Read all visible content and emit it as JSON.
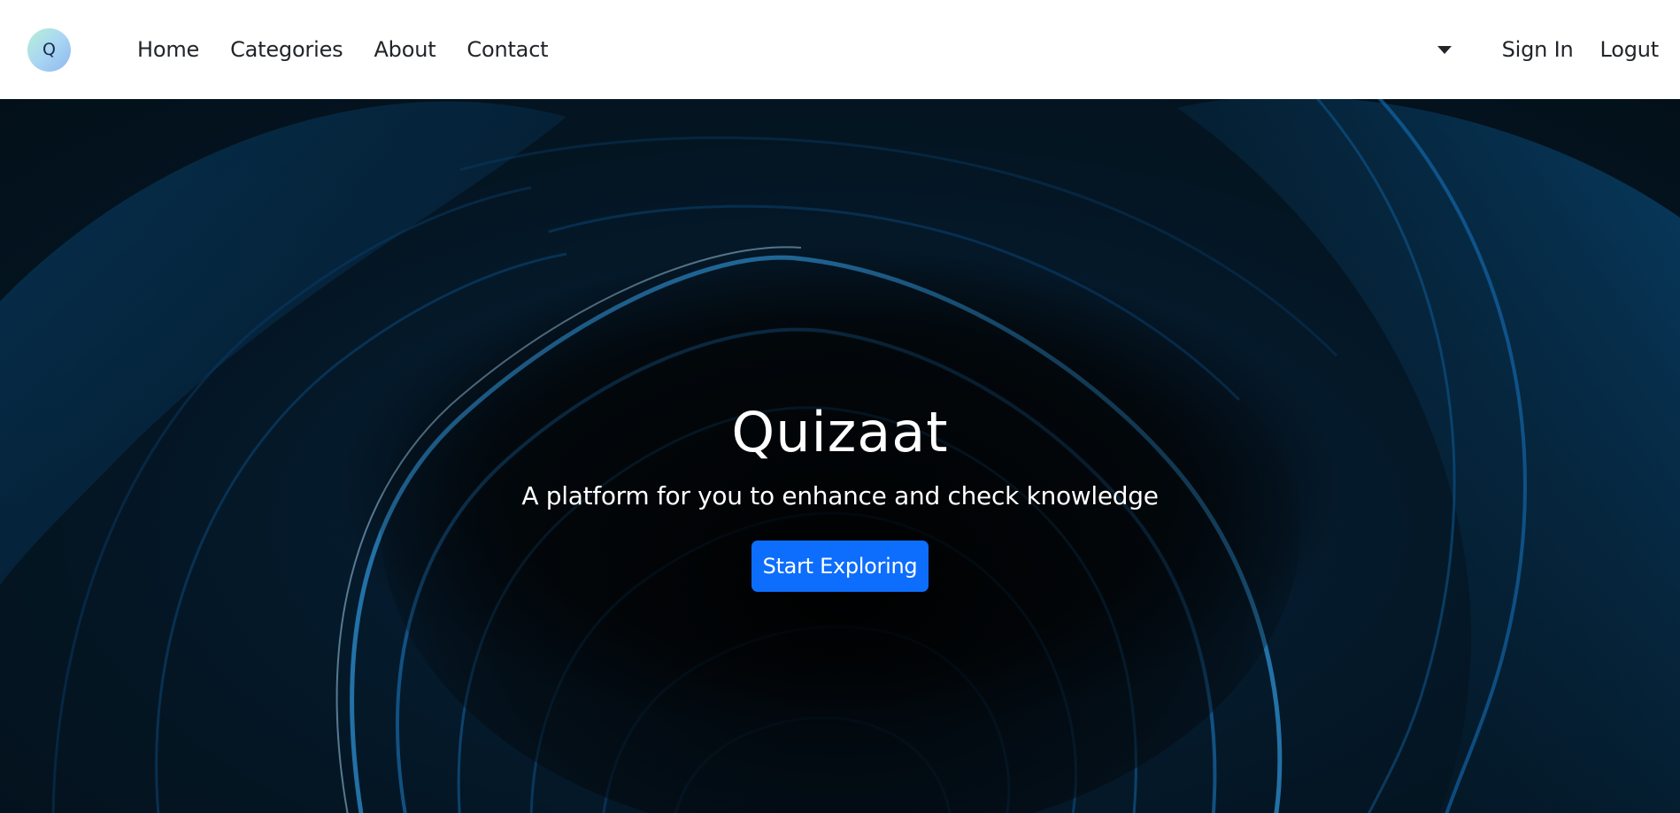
{
  "brand": {
    "logo_letter": "Q",
    "logo_icon": "quiz-logo-icon"
  },
  "nav": {
    "links": [
      "Home",
      "Categories",
      "About",
      "Contact"
    ],
    "dropdown_icon": "caret-down-icon",
    "sign_in": "Sign In",
    "logout": "Logut"
  },
  "hero": {
    "title": "Quizaat",
    "subtitle": "A platform for you to enhance and check knowledge",
    "cta_label": "Start Exploring",
    "background": "dark blue abstract swirl"
  },
  "colors": {
    "navbar_bg": "#ffffff",
    "nav_text": "#212529",
    "primary_button": "#0d6efd",
    "hero_text": "#ffffff",
    "hero_dark": "#03090e",
    "hero_blue": "#0a4a80"
  }
}
